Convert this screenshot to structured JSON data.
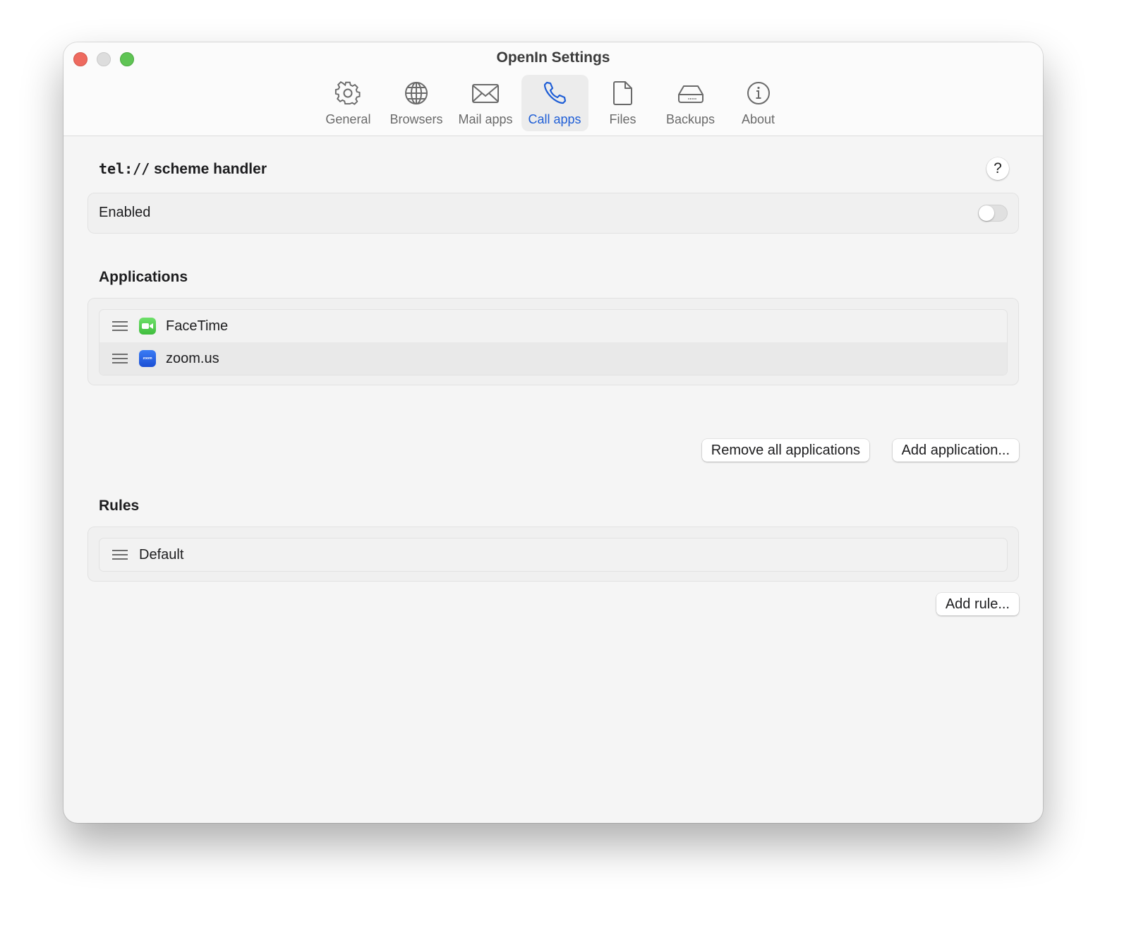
{
  "window": {
    "title": "OpenIn Settings",
    "controls": [
      "close",
      "minimize",
      "zoom"
    ]
  },
  "tabs": [
    {
      "label": "General",
      "icon": "gear-icon",
      "active": false
    },
    {
      "label": "Browsers",
      "icon": "globe-icon",
      "active": false
    },
    {
      "label": "Mail apps",
      "icon": "envelope-icon",
      "active": false
    },
    {
      "label": "Call apps",
      "icon": "phone-icon",
      "active": true
    },
    {
      "label": "Files",
      "icon": "document-icon",
      "active": false
    },
    {
      "label": "Backups",
      "icon": "drive-icon",
      "active": false
    },
    {
      "label": "About",
      "icon": "info-icon",
      "active": false
    }
  ],
  "colors": {
    "accent": "#1f5ed6"
  },
  "handler": {
    "scheme": "tel://",
    "title_suffix": "scheme handler",
    "help_label": "?",
    "enabled_label": "Enabled",
    "enabled": false
  },
  "applications": {
    "title": "Applications",
    "items": [
      {
        "name": "FaceTime",
        "icon": "facetime-icon"
      },
      {
        "name": "zoom.us",
        "icon": "zoom-icon",
        "icon_text": "zoom"
      }
    ],
    "remove_all_label": "Remove all applications",
    "add_label": "Add application..."
  },
  "rules": {
    "title": "Rules",
    "items": [
      {
        "name": "Default"
      }
    ],
    "add_label": "Add rule..."
  }
}
